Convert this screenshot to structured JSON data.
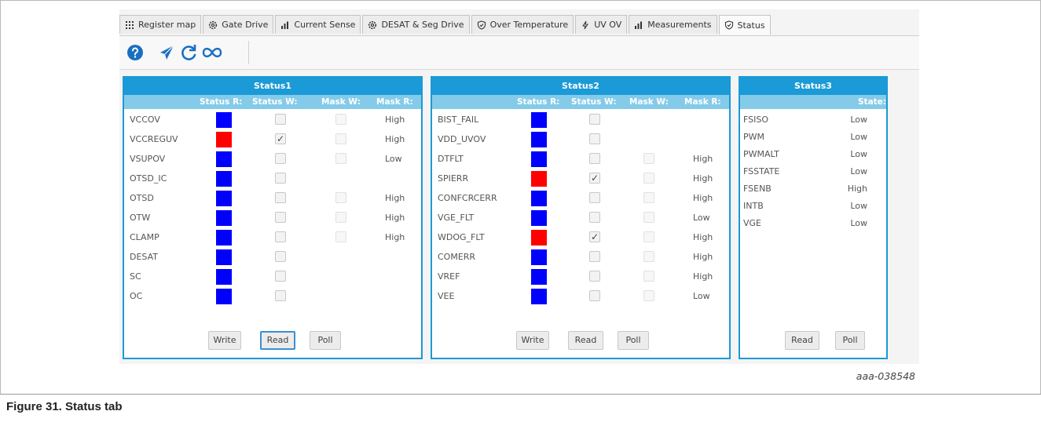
{
  "tabs": [
    {
      "label": "Register map",
      "icon": "grid-icon",
      "active": false
    },
    {
      "label": "Gate Drive",
      "icon": "gear-icon",
      "active": false
    },
    {
      "label": "Current Sense",
      "icon": "bar-chart-icon",
      "active": false
    },
    {
      "label": "DESAT & Seg Drive",
      "icon": "gear-icon",
      "active": false
    },
    {
      "label": "Over Temperature",
      "icon": "shield-check-icon",
      "active": false
    },
    {
      "label": "UV OV",
      "icon": "lightning-icon",
      "active": false
    },
    {
      "label": "Measurements",
      "icon": "bar-chart-icon",
      "active": false
    },
    {
      "label": "Status",
      "icon": "shield-check-icon",
      "active": true
    }
  ],
  "toolbar": {
    "icons": [
      "help-icon",
      "send-icon",
      "refresh-icon",
      "infinity-icon"
    ]
  },
  "colors": {
    "accent": "#1a9ad6",
    "subheader": "#84cbe9",
    "status_ok": "#0000ff",
    "status_fault": "#ff0000"
  },
  "status1": {
    "title": "Status1",
    "headers": [
      "Status R:",
      "Status W:",
      "Mask W:",
      "Mask R:"
    ],
    "rows": [
      {
        "name": "VCCOV",
        "status": "ok",
        "status_w": false,
        "mask_w": true,
        "mask_r": "High"
      },
      {
        "name": "VCCREGUV",
        "status": "fault",
        "status_w": true,
        "mask_w": true,
        "mask_r": "High"
      },
      {
        "name": "VSUPOV",
        "status": "ok",
        "status_w": false,
        "mask_w": true,
        "mask_r": "Low"
      },
      {
        "name": "OTSD_IC",
        "status": "ok",
        "status_w": false,
        "mask_w": false,
        "mask_r": ""
      },
      {
        "name": "OTSD",
        "status": "ok",
        "status_w": false,
        "mask_w": true,
        "mask_r": "High"
      },
      {
        "name": "OTW",
        "status": "ok",
        "status_w": false,
        "mask_w": true,
        "mask_r": "High"
      },
      {
        "name": "CLAMP",
        "status": "ok",
        "status_w": false,
        "mask_w": true,
        "mask_r": "High"
      },
      {
        "name": "DESAT",
        "status": "ok",
        "status_w": false,
        "mask_w": false,
        "mask_r": ""
      },
      {
        "name": "SC",
        "status": "ok",
        "status_w": false,
        "mask_w": false,
        "mask_r": ""
      },
      {
        "name": "OC",
        "status": "ok",
        "status_w": false,
        "mask_w": false,
        "mask_r": ""
      }
    ],
    "buttons": {
      "write": "Write",
      "read": "Read",
      "poll": "Poll"
    }
  },
  "status2": {
    "title": "Status2",
    "headers": [
      "Status R:",
      "Status W:",
      "Mask W:",
      "Mask R:"
    ],
    "rows": [
      {
        "name": "BIST_FAIL",
        "status": "ok",
        "status_w": false,
        "mask_w": false,
        "mask_r": ""
      },
      {
        "name": "VDD_UVOV",
        "status": "ok",
        "status_w": false,
        "mask_w": false,
        "mask_r": ""
      },
      {
        "name": "DTFLT",
        "status": "ok",
        "status_w": false,
        "mask_w": true,
        "mask_r": "High"
      },
      {
        "name": "SPIERR",
        "status": "fault",
        "status_w": true,
        "mask_w": true,
        "mask_r": "High"
      },
      {
        "name": "CONFCRCERR",
        "status": "ok",
        "status_w": false,
        "mask_w": true,
        "mask_r": "High"
      },
      {
        "name": "VGE_FLT",
        "status": "ok",
        "status_w": false,
        "mask_w": true,
        "mask_r": "Low"
      },
      {
        "name": "WDOG_FLT",
        "status": "fault",
        "status_w": true,
        "mask_w": true,
        "mask_r": "High"
      },
      {
        "name": "COMERR",
        "status": "ok",
        "status_w": false,
        "mask_w": true,
        "mask_r": "High"
      },
      {
        "name": "VREF",
        "status": "ok",
        "status_w": false,
        "mask_w": true,
        "mask_r": "High"
      },
      {
        "name": "VEE",
        "status": "ok",
        "status_w": false,
        "mask_w": true,
        "mask_r": "Low"
      }
    ],
    "buttons": {
      "write": "Write",
      "read": "Read",
      "poll": "Poll"
    }
  },
  "status3": {
    "title": "Status3",
    "header": "State:",
    "rows": [
      {
        "name": "FSISO",
        "state": "Low"
      },
      {
        "name": "PWM",
        "state": "Low"
      },
      {
        "name": "PWMALT",
        "state": "Low"
      },
      {
        "name": "FSSTATE",
        "state": "Low"
      },
      {
        "name": "FSENB",
        "state": "High"
      },
      {
        "name": "INTB",
        "state": "Low"
      },
      {
        "name": "VGE",
        "state": "Low"
      }
    ],
    "buttons": {
      "read": "Read",
      "poll": "Poll"
    }
  },
  "figure": {
    "ref": "aaa-038548",
    "caption": "Figure 31.  Status tab"
  }
}
